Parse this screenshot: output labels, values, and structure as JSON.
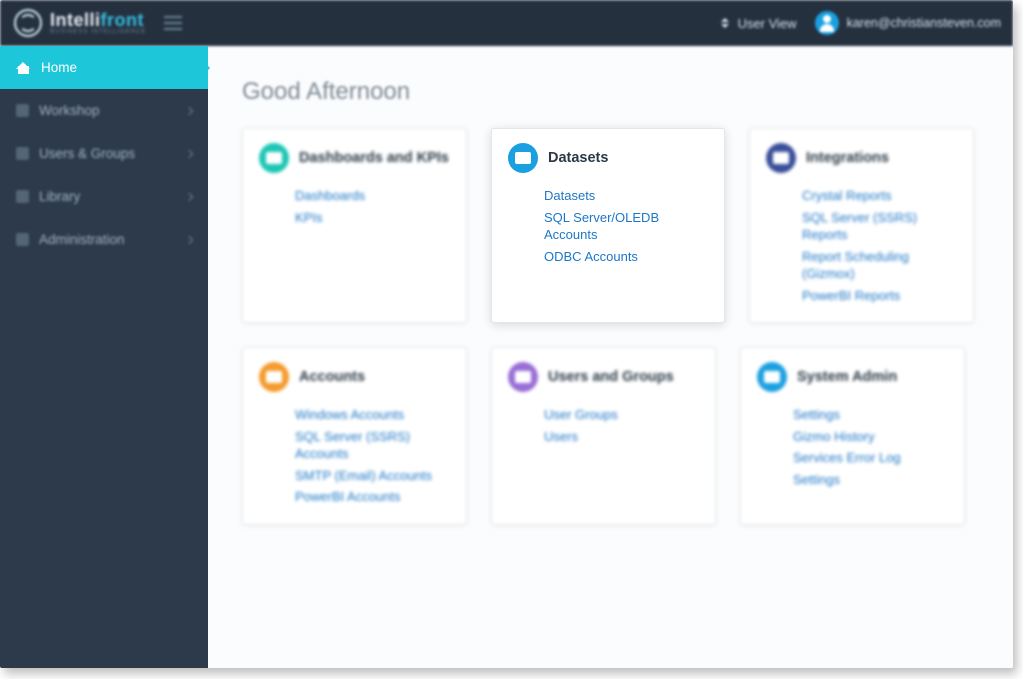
{
  "brand": {
    "part_a": "Intelli",
    "part_b": "front",
    "sub": "BUSINESS INTELLIGENCE"
  },
  "topbar": {
    "user_view": "User View",
    "user_email": "karen@christiansteven.com"
  },
  "sidebar": {
    "items": [
      {
        "label": "Home",
        "icon": "home",
        "active": true
      },
      {
        "label": "Workshop",
        "icon": "generic",
        "active": false
      },
      {
        "label": "Users & Groups",
        "icon": "generic",
        "active": false
      },
      {
        "label": "Library",
        "icon": "generic",
        "active": false
      },
      {
        "label": "Administration",
        "icon": "generic",
        "active": false
      }
    ]
  },
  "main": {
    "greeting": "Good Afternoon",
    "cards": [
      {
        "title": "Dashboards and KPIs",
        "icon_color": "teal",
        "focused": false,
        "links": [
          "Dashboards",
          "KPIs"
        ]
      },
      {
        "title": "Datasets",
        "icon_color": "blue",
        "focused": true,
        "links": [
          "Datasets",
          "SQL Server/OLEDB Accounts",
          "ODBC Accounts"
        ]
      },
      {
        "title": "Integrations",
        "icon_color": "navy",
        "focused": false,
        "links": [
          "Crystal Reports",
          "SQL Server (SSRS) Reports",
          "Report Scheduling (Gizmox)",
          "PowerBI Reports"
        ]
      },
      {
        "title": "Accounts",
        "icon_color": "orange",
        "focused": false,
        "links": [
          "Windows Accounts",
          "SQL Server (SSRS) Accounts",
          "SMTP (Email) Accounts",
          "PowerBI Accounts"
        ]
      },
      {
        "title": "Users and Groups",
        "icon_color": "purple",
        "focused": false,
        "links": [
          "User Groups",
          "Users"
        ]
      },
      {
        "title": "System Admin",
        "icon_color": "tealblue",
        "focused": false,
        "links": [
          "Settings",
          "Gizmo History",
          "Services Error Log",
          "Settings"
        ]
      }
    ]
  }
}
